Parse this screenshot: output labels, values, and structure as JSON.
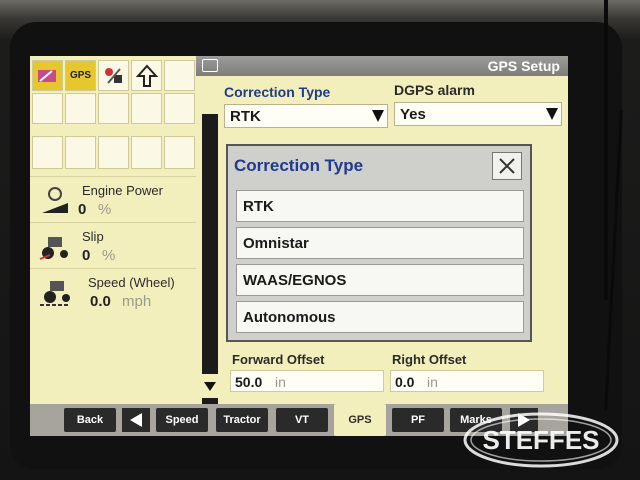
{
  "window": {
    "title": "GPS Setup"
  },
  "left_panel": {
    "gps_tile_label": "GPS",
    "stats": [
      {
        "label": "Engine Power",
        "value": "0",
        "unit": "%"
      },
      {
        "label": "Slip",
        "value": "0",
        "unit": "%"
      },
      {
        "label": "Speed (Wheel)",
        "value": "0.0",
        "unit": "mph"
      }
    ]
  },
  "form": {
    "correction_type": {
      "label": "Correction Type",
      "value": "RTK"
    },
    "dgps_alarm": {
      "label": "DGPS alarm",
      "value": "Yes"
    },
    "forward_offset": {
      "label": "Forward Offset",
      "value": "50.0",
      "unit": "in"
    },
    "right_offset": {
      "label": "Right Offset",
      "value": "0.0",
      "unit": "in"
    }
  },
  "modal": {
    "title": "Correction Type",
    "options": [
      "RTK",
      "Omnistar",
      "WAAS/EGNOS",
      "Autonomous"
    ]
  },
  "tabs": [
    "Back",
    "Speed",
    "Tractor",
    "VT",
    "GPS",
    "PF",
    "Marks"
  ],
  "active_tab": "GPS",
  "watermark": "STEFFES",
  "colors": {
    "screen_bg": "#f3efbc",
    "accent_blue": "#1f3b8c",
    "tab_dark": "#2a2a2a",
    "gps_tile": "#e6c82e"
  }
}
